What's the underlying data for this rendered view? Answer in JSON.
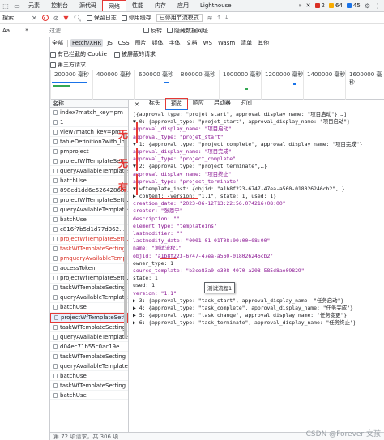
{
  "tabs": [
    "元素",
    "控制台",
    "源代码",
    "网络",
    "性能",
    "内存",
    "应用",
    "Lighthouse"
  ],
  "tabs_right": {
    "more": "»",
    "close": "✕",
    "err_count": "2",
    "warn_count": "64",
    "info_count": "45"
  },
  "toolbar": {
    "preserve_log": "保留日志",
    "disable_cache": "停用缓存",
    "throttle": "已停用节流模式",
    "search_label": "搜索"
  },
  "search": {
    "placeholder": "过滤",
    "aa": "Aa",
    "regex": ".*"
  },
  "filter": {
    "invert": "反转",
    "hide_data_url": "隐藏数据网址"
  },
  "types": [
    "全部",
    "Fetch/XHR",
    "JS",
    "CSS",
    "图片",
    "媒体",
    "字体",
    "文档",
    "WS",
    "Wasm",
    "清单",
    "其他"
  ],
  "filter2": {
    "blocked_cookies": "有已拦截的 Cookie",
    "blocked_requests": "被屏蔽的请求"
  },
  "third_party": "第三方请求",
  "timeline_ticks": [
    "200000 毫秒",
    "400000 毫秒",
    "600000 毫秒",
    "800000 毫秒",
    "1000000 毫秒",
    "1200000 毫秒",
    "1400000 毫秒",
    "1600000 毫秒"
  ],
  "sidebar": {
    "header": "名称",
    "requests": [
      {
        "name": "index?match_key=pm",
        "error": false
      },
      {
        "name": "1",
        "error": false
      },
      {
        "name": "view?match_key=pm…",
        "error": false
      },
      {
        "name": "tableDefinition?with_lo",
        "error": false
      },
      {
        "name": "pmproject",
        "error": false
      },
      {
        "name": "projectWfTemplateSett…",
        "error": false
      },
      {
        "name": "queryAvailableTemplates",
        "error": false
      },
      {
        "name": "batchUse",
        "error": false
      },
      {
        "name": "898cd1dd6e52642860…",
        "error": false
      },
      {
        "name": "projectWfTemplateSett…",
        "error": false
      },
      {
        "name": "queryAvailableTemplates",
        "error": false
      },
      {
        "name": "batchUse",
        "error": false
      },
      {
        "name": "c816f7b5d1d77d362…",
        "error": false
      },
      {
        "name": "projectWfTemplateSett…",
        "error": true
      },
      {
        "name": "taskWfTemplateSetting",
        "error": true
      },
      {
        "name": "pmqueryAvailableTemplates",
        "error": true
      },
      {
        "name": "accessToken",
        "error": false
      },
      {
        "name": "projectWfTemplateSett…",
        "error": false
      },
      {
        "name": "taskWfTemplateSetting",
        "error": false
      },
      {
        "name": "queryAvailableTemplates",
        "error": false
      },
      {
        "name": "batchUse",
        "error": false
      },
      {
        "name": "projectWfTemplateSett…",
        "error": false,
        "selected": true
      },
      {
        "name": "taskWfTemplateSetting",
        "error": false
      },
      {
        "name": "queryAvailableTemplates",
        "error": false
      },
      {
        "name": "d04ec71b55c0ac19e…",
        "error": false
      },
      {
        "name": "taskWfTemplateSetting",
        "error": false
      },
      {
        "name": "queryAvailableTemplates",
        "error": false
      },
      {
        "name": "batchUse",
        "error": false
      },
      {
        "name": "taskWfTemplateSetting",
        "error": false
      },
      {
        "name": "batchUse",
        "error": false
      }
    ]
  },
  "status": "第 72 项请求，共 306 项",
  "detail_tabs": [
    "标头",
    "预览",
    "响应",
    "启动器",
    "时间"
  ],
  "preview_lines": [
    "[{approval_type: \"projet_start\", approval_display_name: \"项目启动\"},…]",
    "▼ 0: {approval_type: \"projet_start\", approval_display_name: \"项目启动\"}",
    "    approval_display_name: \"项目启动\"",
    "    approval_type: \"projet_start\"",
    "▼ 1: {approval_type: \"project_complete\", approval_display_name: \"项目完成\"}",
    "    approval_display_name: \"项目完成\"",
    "    approval_type: \"project_complete\"",
    "▼ 2: {approval_type: \"project_terminate\",…}",
    "    approval_display_name: \"项目终止\"",
    "    approval_type: \"project_terminate\"",
    "  ▼ wftemplate_inst: {objid: \"a1b8f223-6747-47ea-a560-018026246cb2\",…}",
    "    ▶ content: {version: \"1.1\", state: 1, used: 1}",
    "      creation_date: \"2023-06-12T13:22:56.074216+08:00\"",
    "      creator: \"张恩宁\"",
    "      description: \"\"",
    "      element_type: \"templateins\"",
    "      lastmodifier: \"\"",
    "      lastmodify_date: \"0001-01-01T08:00:00+08:00\"",
    "      name: \"测试流程1\"",
    "      objid: \"a1b8f223-6747-47ea-a560-018026246cb2\"",
    "      owner_type: 1",
    "      source_template: \"b3ce83a0-e308-4070-a208-585d8ae09829\"",
    "      state: 1",
    "      used: 1",
    "      version: \"1.1\"",
    "▶ 3: {approval_type: \"task_start\", approval_display_name: \"任务启动\"}",
    "▶ 4: {approval_type: \"task_complete\", approval_display_name: \"任务完成\"}",
    "▶ 5: {approval_type: \"task_change\", approval_display_name: \"任务变更\"}",
    "▶ 6: {approval_type: \"task_terminate\", approval_display_name: \"任务终止\"}"
  ],
  "annotations": {
    "a1": "无",
    "a2": "无",
    "a3": "有"
  },
  "tooltip": "测试流程1",
  "watermark": "CSDN @Forever  女孩"
}
